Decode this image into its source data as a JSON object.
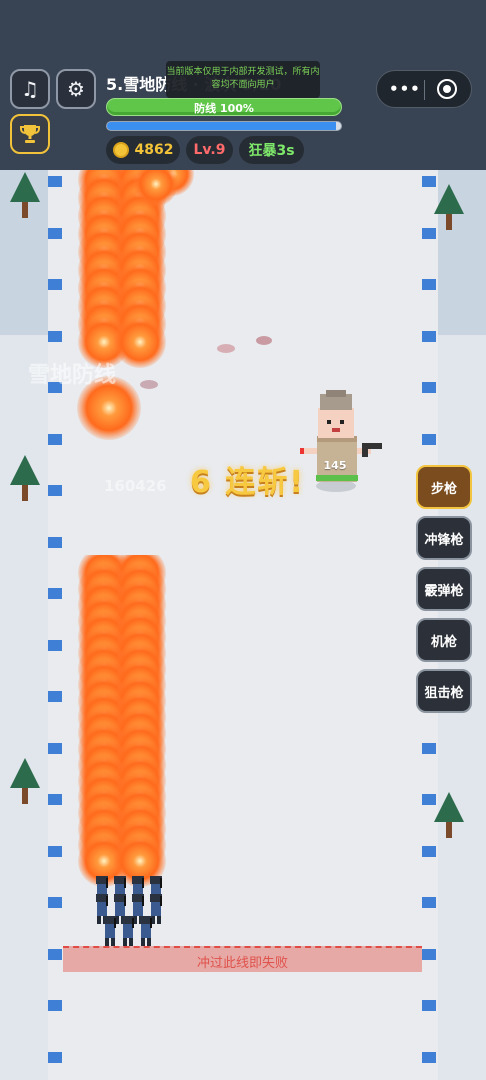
{
  "hud": {
    "title": "5.雪地防线 · 波次 5/20",
    "notice": "当前版本仅用于内部开发测试，所有内容均不面向用户",
    "defense_label": "防线 100%",
    "defense_value": 1.0,
    "xp_value": 0.98,
    "coins": "4862",
    "level": "Lv.9",
    "rage": "狂暴3s",
    "colors": {
      "coin_text": "#f3c338",
      "level_text": "#ff6b6b",
      "rage_text": "#7ee86a",
      "defense": "#60c64a",
      "xp": "#3b8ff0"
    }
  },
  "field": {
    "watermark_title": "雪地防线",
    "watermark_score": "160426",
    "combo_text": "6 连斩!",
    "enemy_hp": "145",
    "deadline_label": "冲过此线即失败"
  },
  "weapons": [
    {
      "label": "步枪",
      "active": true
    },
    {
      "label": "冲锋枪",
      "active": false
    },
    {
      "label": "霰弹枪",
      "active": false
    },
    {
      "label": "机枪",
      "active": false
    },
    {
      "label": "狙击枪",
      "active": false
    }
  ],
  "icons": {
    "music": "music-note-icon",
    "settings": "gear-icon",
    "trophy": "trophy-icon",
    "more": "more-dots-icon",
    "record": "record-icon"
  }
}
